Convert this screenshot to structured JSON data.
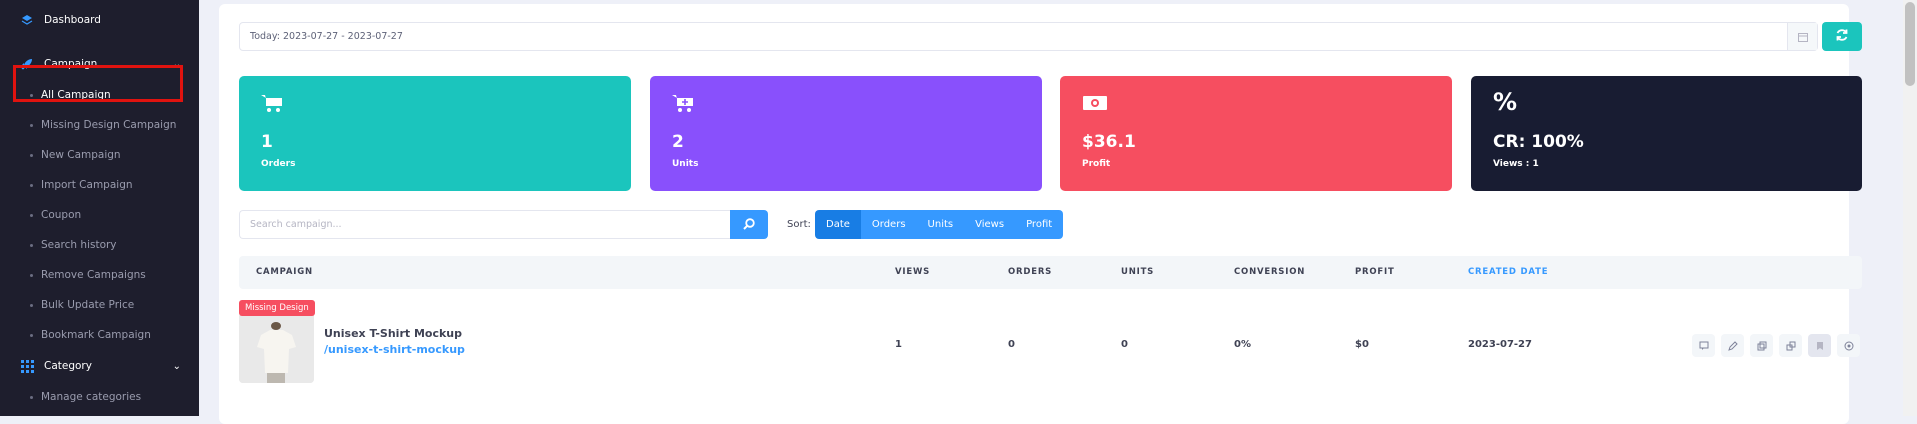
{
  "sidebar": {
    "items": [
      {
        "label": "Dashboard",
        "icon": "dashboard-icon"
      },
      {
        "label": "Campaign",
        "icon": "rocket-icon"
      },
      {
        "label": "Category",
        "icon": "grid-icon"
      }
    ],
    "campaign_sub": [
      "All Campaign",
      "Missing Design Campaign",
      "New Campaign",
      "Import Campaign",
      "Coupon",
      "Search history",
      "Remove Campaigns",
      "Bulk Update Price",
      "Bookmark Campaign"
    ],
    "category_sub": [
      "Manage categories"
    ]
  },
  "filter": {
    "date_range": "Today: 2023-07-27 - 2023-07-27"
  },
  "stats": [
    {
      "value": "1",
      "label": "Orders",
      "color": "#1bc5bd",
      "icon": "cart-icon"
    },
    {
      "value": "2",
      "label": "Units",
      "color": "#8950fc",
      "icon": "cart-plus-icon"
    },
    {
      "value": "$36.1",
      "label": "Profit",
      "color": "#f64e60",
      "icon": "money-icon"
    },
    {
      "value": "CR: 100%",
      "label": "Views : 1",
      "color": "#181c32",
      "icon": "percent-icon"
    }
  ],
  "search": {
    "placeholder": "Search campaign..."
  },
  "sort": {
    "label": "Sort:",
    "options": [
      "Date",
      "Orders",
      "Units",
      "Views",
      "Profit"
    ],
    "active": "Date"
  },
  "table": {
    "headers": [
      "CAMPAIGN",
      "VIEWS",
      "ORDERS",
      "UNITS",
      "CONVERSION",
      "PROFIT",
      "CREATED DATE"
    ],
    "rows": [
      {
        "badge": "Missing Design",
        "name": "Unisex T-Shirt Mockup",
        "slug": "/unisex-t-shirt-mockup",
        "views": "1",
        "orders": "0",
        "units": "0",
        "conversion": "0%",
        "profit": "$0",
        "created": "2023-07-27"
      }
    ]
  },
  "colors": {
    "accent": "#3699ff",
    "teal": "#1bc5bd",
    "sidebar": "#1e1e2d",
    "highlight": "#e0130f"
  }
}
